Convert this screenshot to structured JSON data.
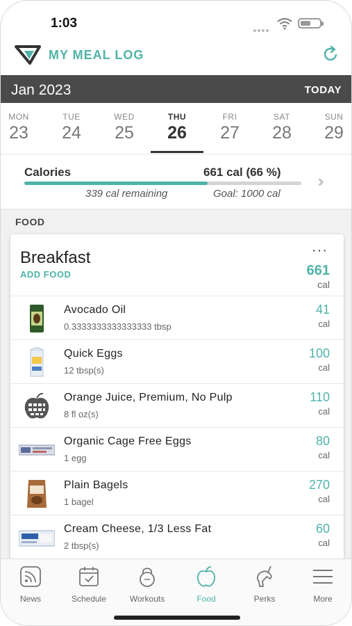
{
  "status": {
    "time": "1:03"
  },
  "header": {
    "title": "MY MEAL LOG",
    "logo_icon": "logo-icon",
    "refresh_icon": "refresh-icon"
  },
  "month": {
    "label": "Jan 2023",
    "today_label": "TODAY"
  },
  "days": [
    {
      "name": "MON",
      "date": "23"
    },
    {
      "name": "TUE",
      "date": "24"
    },
    {
      "name": "WED",
      "date": "25"
    },
    {
      "name": "THU",
      "date": "26",
      "selected": true
    },
    {
      "name": "FRI",
      "date": "27"
    },
    {
      "name": "SAT",
      "date": "28"
    },
    {
      "name": "SUN",
      "date": "29"
    }
  ],
  "calories": {
    "label": "Calories",
    "value": "661 cal (66 %)",
    "progress_fraction": 0.661,
    "remaining": "339 cal remaining",
    "goal": "Goal: 1000 cal"
  },
  "food": {
    "section_title": "FOOD",
    "meal": {
      "title": "Breakfast",
      "add_food_label": "ADD FOOD",
      "more_label": "···",
      "total": "661",
      "total_unit": "cal",
      "items": [
        {
          "name": "Avocado Oil",
          "serving": "0.3333333333333333 tbsp",
          "cal": "41",
          "unit": "cal"
        },
        {
          "name": "Quick Eggs",
          "serving": "12 tbsp(s)",
          "cal": "100",
          "unit": "cal"
        },
        {
          "name": "Orange Juice, Premium, No Pulp",
          "serving": "8 fl oz(s)",
          "cal": "110",
          "unit": "cal"
        },
        {
          "name": "Organic Cage Free Eggs",
          "serving": "1 egg",
          "cal": "80",
          "unit": "cal"
        },
        {
          "name": "Plain Bagels",
          "serving": "1 bagel",
          "cal": "270",
          "unit": "cal"
        },
        {
          "name": "Cream Cheese, 1/3 Less Fat",
          "serving": "2 tbsp(s)",
          "cal": "60",
          "unit": "cal"
        }
      ]
    }
  },
  "tabs": [
    {
      "label": "News",
      "icon": "news-icon"
    },
    {
      "label": "Schedule",
      "icon": "calendar-icon"
    },
    {
      "label": "Workouts",
      "icon": "kettlebell-icon"
    },
    {
      "label": "Food",
      "icon": "apple-icon",
      "active": true
    },
    {
      "label": "Perks",
      "icon": "unicorn-icon"
    },
    {
      "label": "More",
      "icon": "menu-icon"
    }
  ],
  "colors": {
    "accent": "#4fb3a9",
    "month_bar": "#4a4a4a"
  }
}
